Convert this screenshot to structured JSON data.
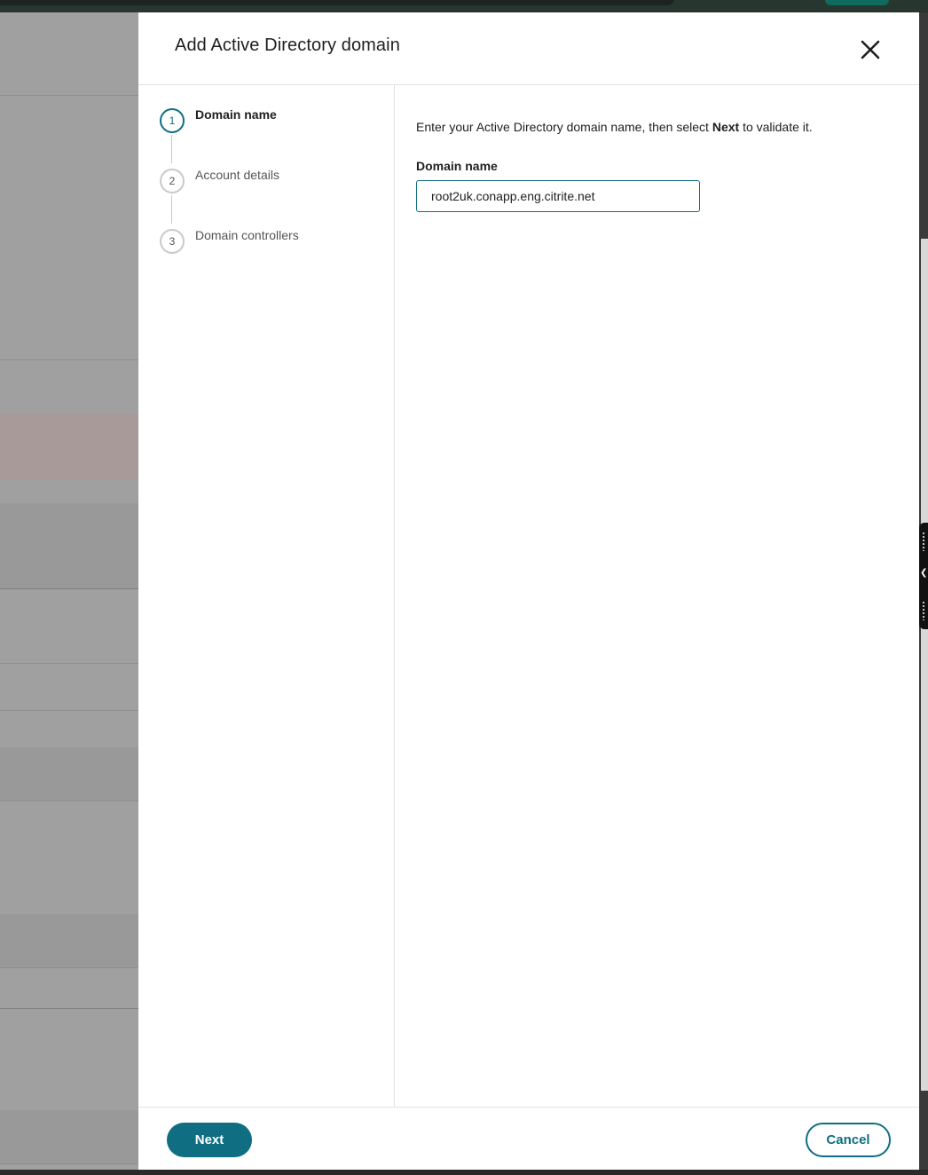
{
  "dialog": {
    "title": "Add Active Directory domain",
    "close_icon": "close-icon"
  },
  "steps": [
    {
      "number": "1",
      "label": "Domain name",
      "active": true
    },
    {
      "number": "2",
      "label": "Account details",
      "active": false
    },
    {
      "number": "3",
      "label": "Domain controllers",
      "active": false
    }
  ],
  "content": {
    "instruction_prefix": "Enter your Active Directory domain name, then select ",
    "instruction_bold": "Next",
    "instruction_suffix": " to validate it.",
    "domain_label": "Domain name",
    "domain_value": "root2uk.conapp.eng.citrite.net"
  },
  "footer": {
    "next_label": "Next",
    "cancel_label": "Cancel"
  },
  "colors": {
    "accent": "#0f6e82",
    "backdrop": "#a0a0a0",
    "highlight_row": "#a99a9a"
  }
}
